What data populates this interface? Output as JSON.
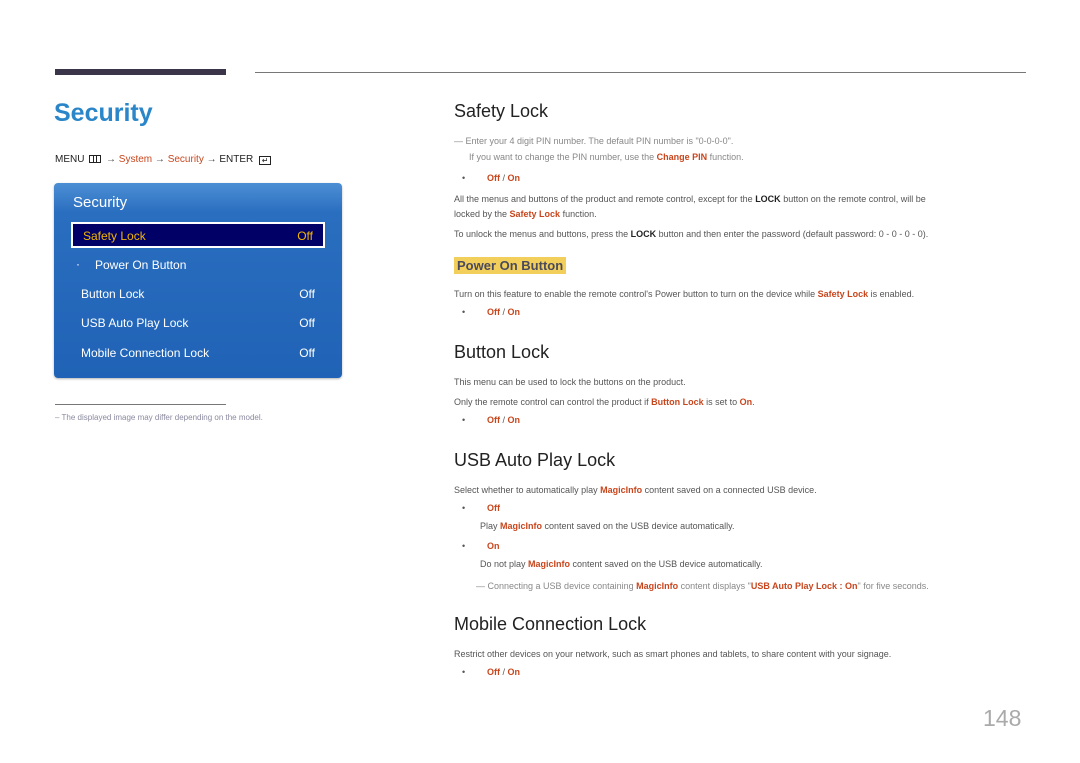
{
  "page": {
    "title": "Security",
    "page_number": "148",
    "footnote": "–  The displayed image may differ depending on the model."
  },
  "breadcrumb": {
    "menu": "MENU",
    "arrow": "→",
    "system": "System",
    "security": "Security",
    "enter": "ENTER"
  },
  "osd": {
    "title": "Security",
    "items": [
      {
        "label": "Safety Lock",
        "value": "Off"
      },
      {
        "label": "Power On Button",
        "value": "",
        "bullet": "·"
      },
      {
        "label": "Button Lock",
        "value": "Off"
      },
      {
        "label": "USB Auto Play Lock",
        "value": "Off"
      },
      {
        "label": "Mobile Connection Lock",
        "value": "Off"
      }
    ]
  },
  "sections": {
    "safety_lock": {
      "title": "Safety Lock",
      "note1": "Enter your 4 digit PIN number. The default PIN number is \"0-0-0-0\".",
      "note2_pre": "If you want to change the PIN number, use the ",
      "note2_bold": "Change PIN",
      "note2_post": " function.",
      "options_off": "Off",
      "options_on": "On",
      "para1_a": "All the menus and buttons of the product and remote control, except for the ",
      "para1_b": "LOCK",
      "para1_c": " button on the remote control, will be",
      "para1_d": "locked by the ",
      "para1_e": "Safety Lock",
      "para1_f": " function.",
      "para2_a": "To unlock the menus and buttons, press the ",
      "para2_b": "LOCK",
      "para2_c": " button and then enter the password (default password: 0 - 0 - 0 - 0)."
    },
    "power_on_button": {
      "title": "Power On Button",
      "para_a": "Turn on this feature to enable the remote control's Power button to turn on the device while ",
      "para_b": "Safety Lock",
      "para_c": " is enabled.",
      "options_off": "Off",
      "options_on": "On"
    },
    "button_lock": {
      "title": "Button Lock",
      "para1": "This menu can be used to lock the buttons on the product.",
      "para2_a": "Only the remote control can control the product if ",
      "para2_b": "Button Lock",
      "para2_c": " is set to ",
      "para2_d": "On",
      "para2_e": ".",
      "options_off": "Off",
      "options_on": "On"
    },
    "usb_auto_play_lock": {
      "title": "USB Auto Play Lock",
      "para_a": "Select whether to automatically play ",
      "para_b": "MagicInfo",
      "para_c": " content saved on a connected USB device.",
      "off_label": "Off",
      "off_desc_a": "Play ",
      "off_desc_b": "MagicInfo",
      "off_desc_c": " content saved on the USB device automatically.",
      "on_label": "On",
      "on_desc_a": "Do not play ",
      "on_desc_b": "MagicInfo",
      "on_desc_c": " content saved on the USB device automatically.",
      "note_a": "Connecting a USB device containing ",
      "note_b": "MagicInfo",
      "note_c": " content displays \"",
      "note_d": "USB Auto Play Lock : On",
      "note_e": "\" for five seconds."
    },
    "mobile_connection_lock": {
      "title": "Mobile Connection Lock",
      "para": "Restrict other devices on your network, such as smart phones and tablets, to share content with your signage.",
      "options_off": "Off",
      "options_on": "On"
    }
  },
  "colors": {
    "title_blue": "#2a86c8",
    "highlight_orange": "#c8461d",
    "osd_blue": "#2063b6",
    "osd_selected": "#000066",
    "osd_selected_text": "#f2b600",
    "subheading_bg": "#f2cf5b"
  }
}
